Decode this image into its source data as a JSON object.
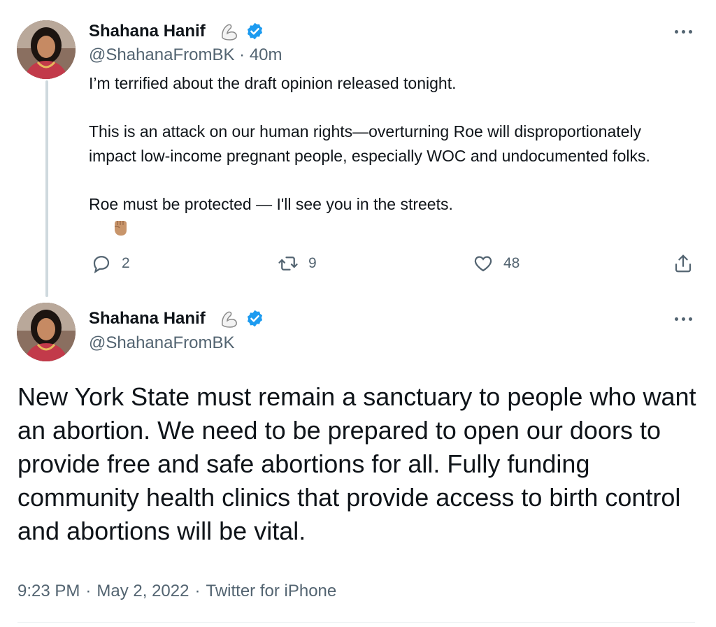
{
  "tweet1": {
    "author_name": "Shahana Hanif",
    "handle": "@ShahanaFromBK",
    "separator": "·",
    "time": "40m",
    "paragraphs": [
      "I’m terrified about the draft opinion released tonight.",
      "This is an attack on our human rights—overturning Roe will disproportionately impact low-income pregnant people, especially WOC and undocumented folks.",
      "Roe must be protected — I'll see you in the streets."
    ],
    "fist_emoji": "✊🏽",
    "replies": "2",
    "retweets": "9",
    "likes": "48"
  },
  "tweet2": {
    "author_name": "Shahana Hanif",
    "handle": "@ShahanaFromBK",
    "text": "New York State must remain a sanctuary to people who want an abortion. We need to be prepared to open our doors to provide free and safe abortions for all. Fully funding community health clinics that provide access to birth control and abortions will be vital.",
    "time": "9:23 PM",
    "date": "May 2, 2022",
    "source": "Twitter for iPhone",
    "dot": "·"
  },
  "icons": {
    "arm_emoji": "flexed-biceps-emoji",
    "verified": "verified-badge-icon",
    "more": "more-icon",
    "reply": "reply-icon",
    "retweet": "retweet-icon",
    "like": "like-icon",
    "share": "share-icon"
  },
  "colors": {
    "text_primary": "#0f1419",
    "text_secondary": "#536471",
    "verified_blue": "#1d9bf0",
    "thread_line": "#cfd9de"
  }
}
